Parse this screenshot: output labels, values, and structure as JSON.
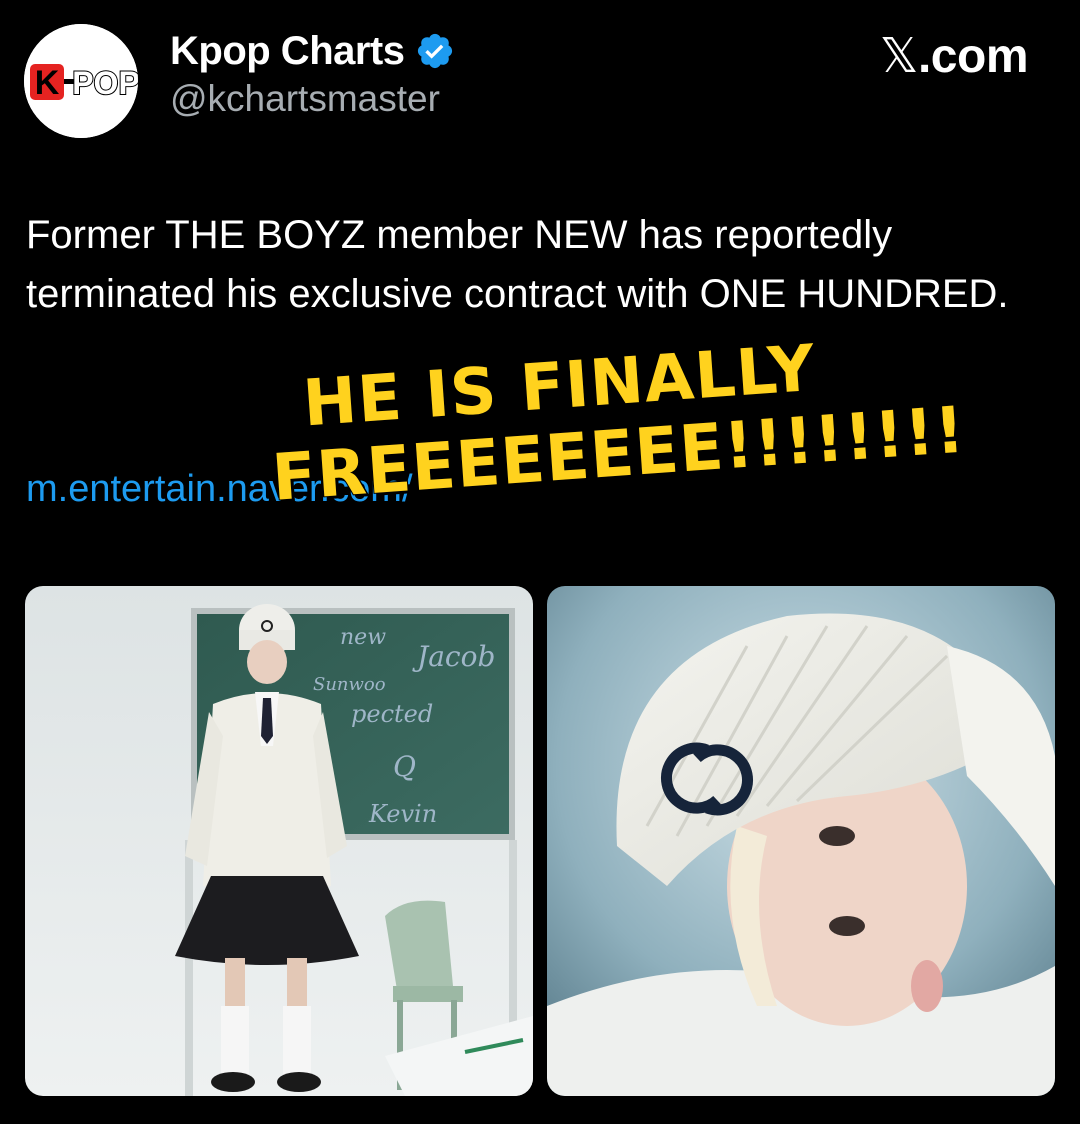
{
  "account": {
    "avatar_logo_text": "K-POP",
    "display_name": "Kpop Charts",
    "handle": "@kchartsmaster",
    "verified_icon": "verified-badge-icon"
  },
  "source": {
    "x_glyph": "𝕏",
    "domain": ".com"
  },
  "tweet": {
    "text": "Former THE BOYZ member NEW has reportedly terminated his exclusive contract with ONE HUNDRED.",
    "link_text": "m.entertain.naver.com/"
  },
  "overlay": {
    "line1": "HE IS FINALLY",
    "line2": "FREEEEEEEE!!!!!!!!"
  },
  "media": {
    "left_photo": {
      "chalkboard_words": [
        "new",
        "Jacob",
        "Sunwoo",
        "pected",
        "Q",
        "Kevin"
      ]
    },
    "right_photo": {}
  },
  "colors": {
    "background": "#000000",
    "link": "#1d9bf0",
    "verified": "#1d9bf0",
    "overlay_text": "#ffd21e",
    "handle": "#a7adb2"
  }
}
